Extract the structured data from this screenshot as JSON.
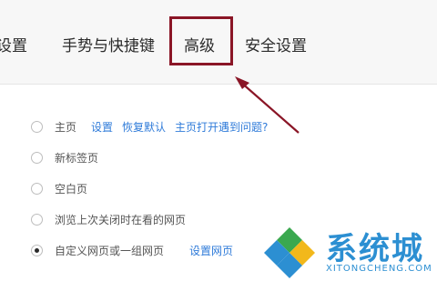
{
  "tabs": [
    {
      "label": "设置",
      "partial": true
    },
    {
      "label": "手势与快捷键"
    },
    {
      "label": "高级",
      "highlighted": true
    },
    {
      "label": "安全设置"
    }
  ],
  "homepage_options": [
    {
      "label": "主页",
      "selected": false,
      "links": [
        "设置",
        "恢复默认",
        "主页打开遇到问题?"
      ]
    },
    {
      "label": "新标签页",
      "selected": false,
      "links": []
    },
    {
      "label": "空白页",
      "selected": false,
      "links": []
    },
    {
      "label": "浏览上次关闭时在看的网页",
      "selected": false,
      "links": []
    },
    {
      "label": "自定义网页或一组网页",
      "selected": true,
      "links": [
        "设置网页"
      ]
    }
  ],
  "watermark": {
    "name": "系统城",
    "url": "XITONGCHENG.COM"
  },
  "colors": {
    "highlight_box": "#8a1526",
    "link": "#2f7bd9",
    "watermark": "#2c8fd2"
  }
}
